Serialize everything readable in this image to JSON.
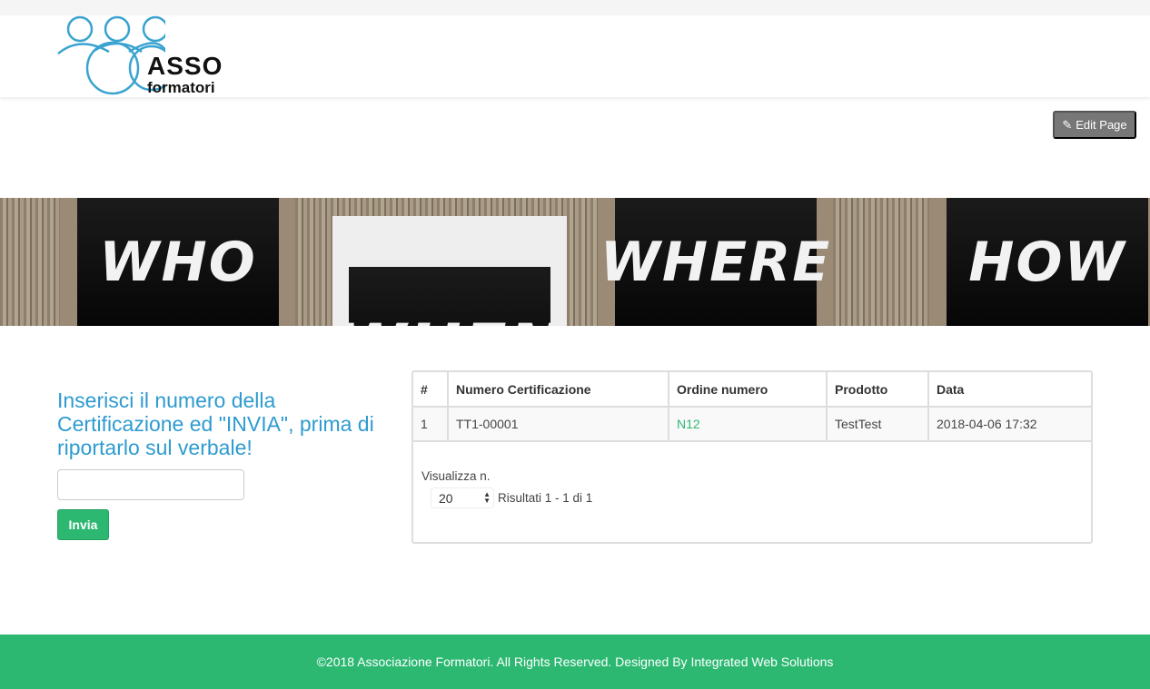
{
  "logo": {
    "line1": "ASSO",
    "line2": "formatori"
  },
  "toolbar": {
    "edit_label": "Edit Page"
  },
  "banner": {
    "words": [
      "WHO",
      "WHEN",
      "WHERE",
      "HOW"
    ]
  },
  "form": {
    "title": "Inserisci il numero della Certificazione ed \"INVIA\", prima di riportarlo sul verbale!",
    "input_value": "",
    "submit_label": "Invia"
  },
  "table": {
    "headers": [
      "#",
      "Numero Certificazione",
      "Ordine numero",
      "Prodotto",
      "Data"
    ],
    "rows": [
      [
        "1",
        "TT1-00001",
        "N12",
        "TestTest",
        "2018-04-06 17:32"
      ]
    ]
  },
  "pagination": {
    "show_label": "Visualizza n.",
    "page_size": "20",
    "results": "Risultati 1 - 1 di 1"
  },
  "footer": {
    "text": "©2018 Associazione Formatori. All Rights Reserved. Designed By Integrated Web Solutions"
  }
}
